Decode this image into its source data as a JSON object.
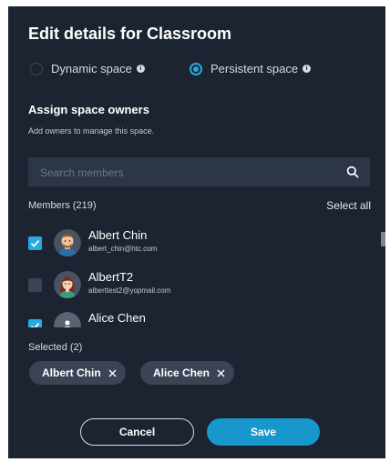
{
  "dialog": {
    "title": "Edit details for Classroom",
    "space_type": {
      "options": [
        {
          "label": "Dynamic space",
          "selected": false
        },
        {
          "label": "Persistent space",
          "selected": true
        }
      ]
    },
    "owners_heading": "Assign space owners",
    "owners_subtitle": "Add owners to manage this space.",
    "search": {
      "placeholder": "Search members",
      "value": ""
    },
    "members_label": "Members (219)",
    "select_all_label": "Select all",
    "members": [
      {
        "name": "Albert Chin",
        "email": "albert_chin@htc.com",
        "checked": true,
        "avatar": "male-avatar"
      },
      {
        "name": "AlbertT2",
        "email": "alberttest2@yopmail.com",
        "checked": false,
        "avatar": "female-avatar"
      },
      {
        "name": "Alice Chen",
        "email": "",
        "checked": true,
        "avatar": "default-avatar"
      }
    ],
    "selected_label": "Selected (2)",
    "selected_chips": [
      "Albert Chin",
      "Alice Chen"
    ],
    "cancel_label": "Cancel",
    "save_label": "Save"
  },
  "colors": {
    "background": "#1c2431",
    "accent": "#28a9e0",
    "save_button": "#1897cc",
    "chip": "#3b4454"
  }
}
